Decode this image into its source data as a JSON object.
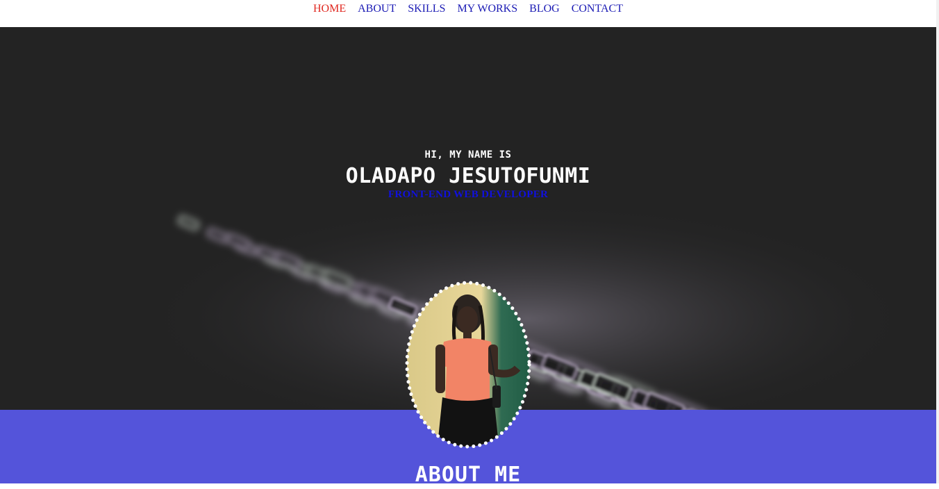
{
  "nav": {
    "items": [
      {
        "label": "HOME",
        "active": true
      },
      {
        "label": "ABOUT",
        "active": false
      },
      {
        "label": "SKILLS",
        "active": false
      },
      {
        "label": "MY WORKS",
        "active": false
      },
      {
        "label": "BLOG",
        "active": false
      },
      {
        "label": "CONTACT",
        "active": false
      }
    ]
  },
  "hero": {
    "greeting": "HI, MY NAME IS",
    "name": "OLADAPO JESUTOFUNMI",
    "role": "FRONT-END WEB DEVELOPER",
    "background_image": "backlit-keyboard"
  },
  "about": {
    "title": "ABOUT ME"
  },
  "colors": {
    "nav_link": "#1a1ab4",
    "nav_active": "#e0271f",
    "hero_bg": "#232323",
    "about_band": "#5454da",
    "role_text": "#1010e0"
  }
}
